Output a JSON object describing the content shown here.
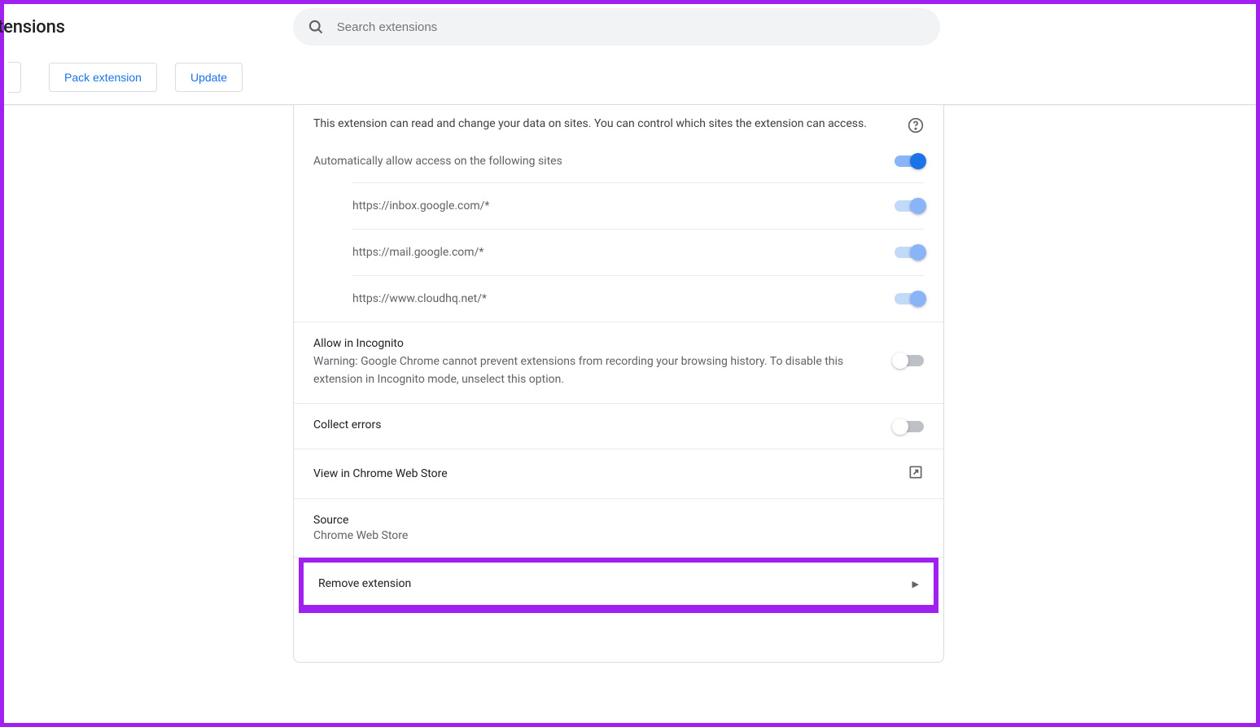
{
  "header": {
    "page_title": "tensions",
    "search_placeholder": "Search extensions"
  },
  "toolbar": {
    "pack_label": "Pack extension",
    "update_label": "Update"
  },
  "site_access": {
    "description": "This extension can read and change your data on sites. You can control which sites the extension can access.",
    "auto_allow_label": "Automatically allow access on the following sites",
    "sites": [
      {
        "url": "https://inbox.google.com/*"
      },
      {
        "url": "https://mail.google.com/*"
      },
      {
        "url": "https://www.cloudhq.net/*"
      }
    ]
  },
  "incognito": {
    "title": "Allow in Incognito",
    "warning": "Warning: Google Chrome cannot prevent extensions from recording your browsing history. To disable this extension in Incognito mode, unselect this option."
  },
  "collect_errors": {
    "label": "Collect errors"
  },
  "webstore": {
    "label": "View in Chrome Web Store"
  },
  "source": {
    "label": "Source",
    "value": "Chrome Web Store"
  },
  "remove": {
    "label": "Remove extension"
  }
}
